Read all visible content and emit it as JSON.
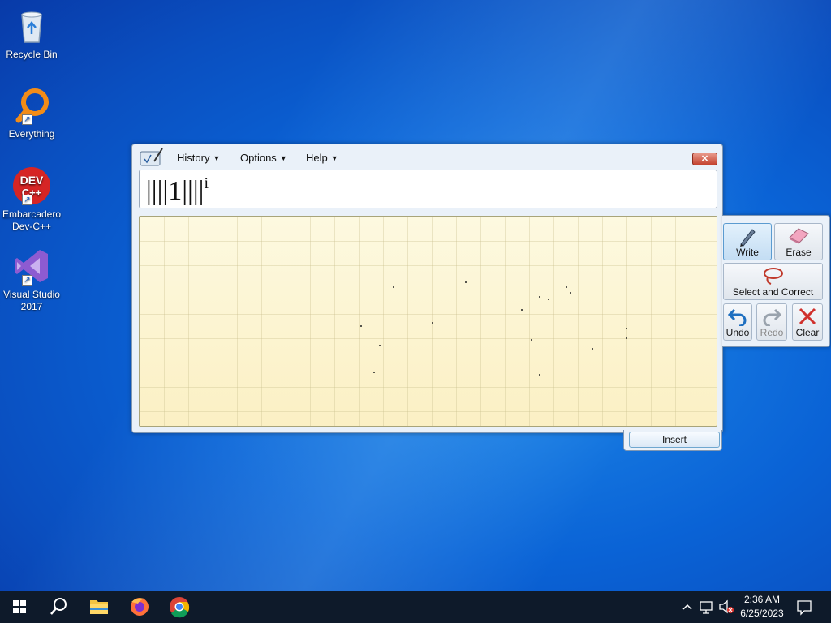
{
  "desktop": {
    "icons": [
      {
        "label": "Recycle Bin"
      },
      {
        "label": "Everything"
      },
      {
        "label": "Embarcadero Dev-C++"
      },
      {
        "label": "Visual Studio 2017"
      }
    ]
  },
  "tip": {
    "menu": {
      "history": "History",
      "options": "Options",
      "help": "Help"
    },
    "close_symbol": "✕",
    "preview": {
      "text": "||||1||||",
      "superscript": "i"
    },
    "insert_label": "Insert",
    "toolbar": {
      "write": "Write",
      "erase": "Erase",
      "select_correct": "Select and Correct",
      "undo": "Undo",
      "redo": "Redo",
      "clear": "Clear"
    }
  },
  "taskbar": {
    "pinned": [
      "start-icon",
      "search-icon",
      "file-explorer-icon",
      "firefox-icon",
      "chrome-icon"
    ],
    "clock": {
      "time": "2:36 AM",
      "date": "6/25/2023"
    }
  }
}
